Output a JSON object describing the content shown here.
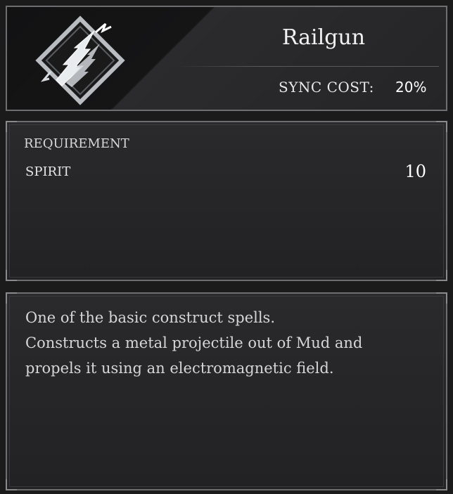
{
  "spell": {
    "name": "Railgun",
    "icon": "lightning-bolt-diamond-icon",
    "sync_cost_label": "SYNC COST:",
    "sync_cost_value": "20%"
  },
  "requirement": {
    "heading": "REQUIREMENT",
    "items": [
      {
        "name": "SPIRIT",
        "value": "10"
      }
    ]
  },
  "description": {
    "lines": [
      "One of the basic construct spells.",
      "Constructs a metal projectile out of Mud and",
      "propels it using an electromagnetic field."
    ]
  },
  "colors": {
    "background": "#1b1b1c",
    "panel": "#242426",
    "border": "#6e6e70",
    "text": "#e6e6e6"
  }
}
